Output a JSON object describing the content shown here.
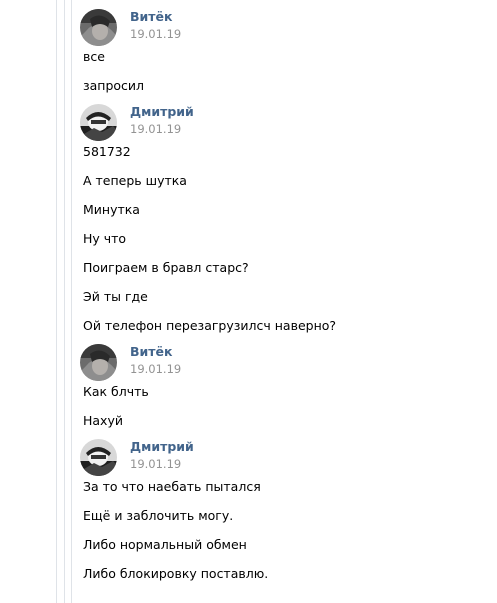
{
  "dialog": {
    "groups": [
      {
        "author": "Витёк",
        "date": "19.01.19",
        "avatar_icon": "user-photo-dark",
        "messages": [
          "все",
          "запросил"
        ]
      },
      {
        "author": "Дмитрий",
        "date": "19.01.19",
        "avatar_icon": "user-photo-mono",
        "messages": [
          "581732",
          "А теперь шутка",
          "Минутка",
          "Ну что",
          "Поиграем в бравл старс?",
          "Эй ты где",
          "Ой телефон перезагрузилсч наверно?"
        ]
      },
      {
        "author": "Витёк",
        "date": "19.01.19",
        "avatar_icon": "user-photo-dark",
        "messages": [
          "Как блчть",
          "Нахуй"
        ]
      },
      {
        "author": "Дмитрий",
        "date": "19.01.19",
        "avatar_icon": "user-photo-mono",
        "messages": [
          "За то что наебать пытался",
          "Ещё и заблочить могу.",
          "Либо нормальный обмен",
          "Либо блокировку поставлю."
        ]
      }
    ]
  },
  "colors": {
    "author_name": "#42648b",
    "date": "#939393",
    "message_text": "#000000",
    "rule": "#dfe3e8"
  }
}
